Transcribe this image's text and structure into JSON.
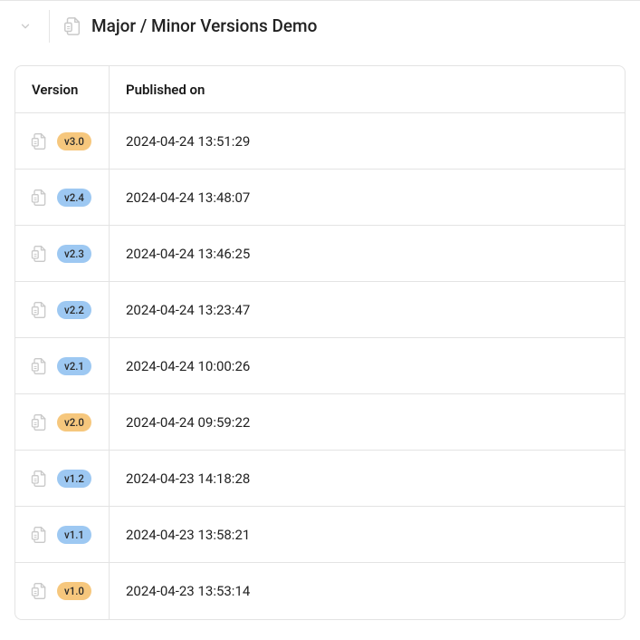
{
  "header": {
    "title": "Major / Minor Versions Demo"
  },
  "table": {
    "columns": {
      "version": "Version",
      "published": "Published on"
    },
    "rows": [
      {
        "version": "v3.0",
        "type": "major",
        "published": "2024-04-24 13:51:29"
      },
      {
        "version": "v2.4",
        "type": "minor",
        "published": "2024-04-24 13:48:07"
      },
      {
        "version": "v2.3",
        "type": "minor",
        "published": "2024-04-24 13:46:25"
      },
      {
        "version": "v2.2",
        "type": "minor",
        "published": "2024-04-24 13:23:47"
      },
      {
        "version": "v2.1",
        "type": "minor",
        "published": "2024-04-24 10:00:26"
      },
      {
        "version": "v2.0",
        "type": "major",
        "published": "2024-04-24 09:59:22"
      },
      {
        "version": "v1.2",
        "type": "minor",
        "published": "2024-04-23 14:18:28"
      },
      {
        "version": "v1.1",
        "type": "minor",
        "published": "2024-04-23 13:58:21"
      },
      {
        "version": "v1.0",
        "type": "major",
        "published": "2024-04-23 13:53:14"
      }
    ]
  },
  "colors": {
    "major_badge": "#f6c77d",
    "minor_badge": "#9dc8f2",
    "border": "#e3e3e3"
  }
}
